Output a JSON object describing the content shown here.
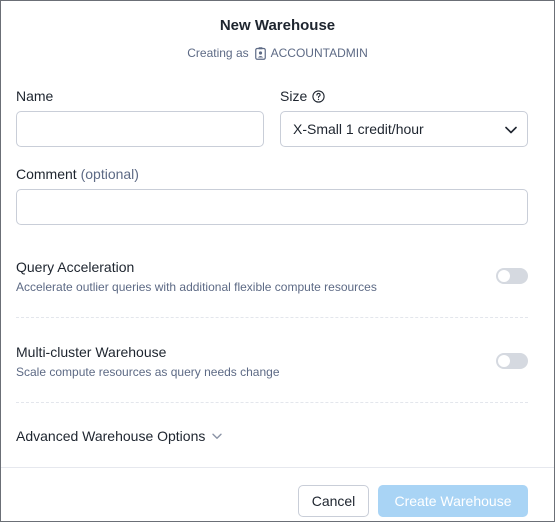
{
  "dialog": {
    "title": "New Warehouse",
    "subtitle_prefix": "Creating as",
    "role_icon": "user-badge-icon",
    "role": "ACCOUNTADMIN"
  },
  "form": {
    "name_label": "Name",
    "name_value": "",
    "size_label": "Size",
    "size_help_icon": "help-circle-icon",
    "size_value": "X-Small 1 credit/hour",
    "comment_label": "Comment",
    "comment_optional": "(optional)",
    "comment_value": ""
  },
  "options": {
    "query_acceleration": {
      "title": "Query Acceleration",
      "description": "Accelerate outlier queries with additional flexible compute resources",
      "enabled": false
    },
    "multi_cluster": {
      "title": "Multi-cluster Warehouse",
      "description": "Scale compute resources as query needs change",
      "enabled": false
    },
    "advanced_label": "Advanced Warehouse Options"
  },
  "footer": {
    "cancel_label": "Cancel",
    "create_label": "Create Warehouse",
    "create_disabled": true
  },
  "colors": {
    "primary_disabled": "#a9d4f5",
    "text": "#1e252f",
    "muted_text": "#5d6a85",
    "border": "#c9ced8"
  }
}
